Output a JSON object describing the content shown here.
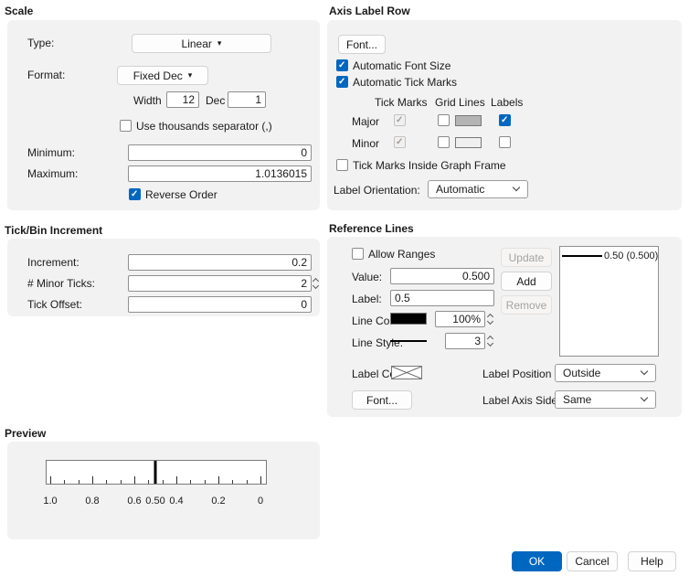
{
  "scale": {
    "title": "Scale",
    "type_label": "Type:",
    "type_value": "Linear",
    "format_label": "Format:",
    "format_value": "Fixed Dec",
    "width_label": "Width",
    "width_value": "12",
    "dec_label": "Dec",
    "dec_value": "1",
    "thousands_label": "Use thousands separator (,)",
    "minimum_label": "Minimum:",
    "minimum_value": "0",
    "maximum_label": "Maximum:",
    "maximum_value": "1.0136015",
    "reverse_label": "Reverse Order"
  },
  "tick_bin": {
    "title": "Tick/Bin Increment",
    "increment_label": "Increment:",
    "increment_value": "0.2",
    "minor_ticks_label": "# Minor Ticks:",
    "minor_ticks_value": "2",
    "tick_offset_label": "Tick Offset:",
    "tick_offset_value": "0"
  },
  "axis_label_row": {
    "title": "Axis Label Row",
    "font_button": "Font...",
    "auto_font_label": "Automatic Font Size",
    "auto_tick_label": "Automatic Tick Marks",
    "columns": [
      "Tick Marks",
      "Grid Lines",
      "Labels"
    ],
    "major_label": "Major",
    "minor_label": "Minor",
    "inside_label": "Tick Marks Inside Graph Frame",
    "orientation_label": "Label Orientation:",
    "orientation_value": "Automatic"
  },
  "reference_lines": {
    "title": "Reference Lines",
    "allow_ranges_label": "Allow Ranges",
    "value_label": "Value:",
    "value_value": "0.500",
    "label_label": "Label:",
    "label_value": "0.5",
    "line_color_label": "Line Color:",
    "line_width_value": "100%",
    "line_style_label": "Line Style:",
    "line_style_value": "3",
    "update_button": "Update",
    "add_button": "Add",
    "remove_button": "Remove",
    "list_items": [
      "0.50 (0.500)"
    ],
    "label_color_label": "Label Color",
    "font_button": "Font...",
    "label_position_label": "Label Position",
    "label_position_value": "Outside",
    "label_axis_side_label": "Label Axis Side",
    "label_axis_side_value": "Same"
  },
  "preview": {
    "title": "Preview",
    "tick_labels": [
      "1.0",
      "0.8",
      "0.6",
      "0.50",
      "0.4",
      "0.2",
      "0"
    ]
  },
  "footer": {
    "ok": "OK",
    "cancel": "Cancel",
    "help": "Help"
  },
  "checks": {
    "thousands": false,
    "reverse_order": true,
    "auto_font_size": true,
    "auto_tick_marks": true,
    "major_tick_marks": true,
    "major_grid_lines": false,
    "major_labels": true,
    "minor_tick_marks": true,
    "minor_grid_lines": false,
    "minor_labels": false,
    "inside_frame": false,
    "allow_ranges": false
  },
  "colors": {
    "accent": "#0067c0",
    "major_grid_swatch": "#b4b4b4",
    "minor_grid_swatch": "#efefef",
    "line_color_swatch": "#000000"
  }
}
